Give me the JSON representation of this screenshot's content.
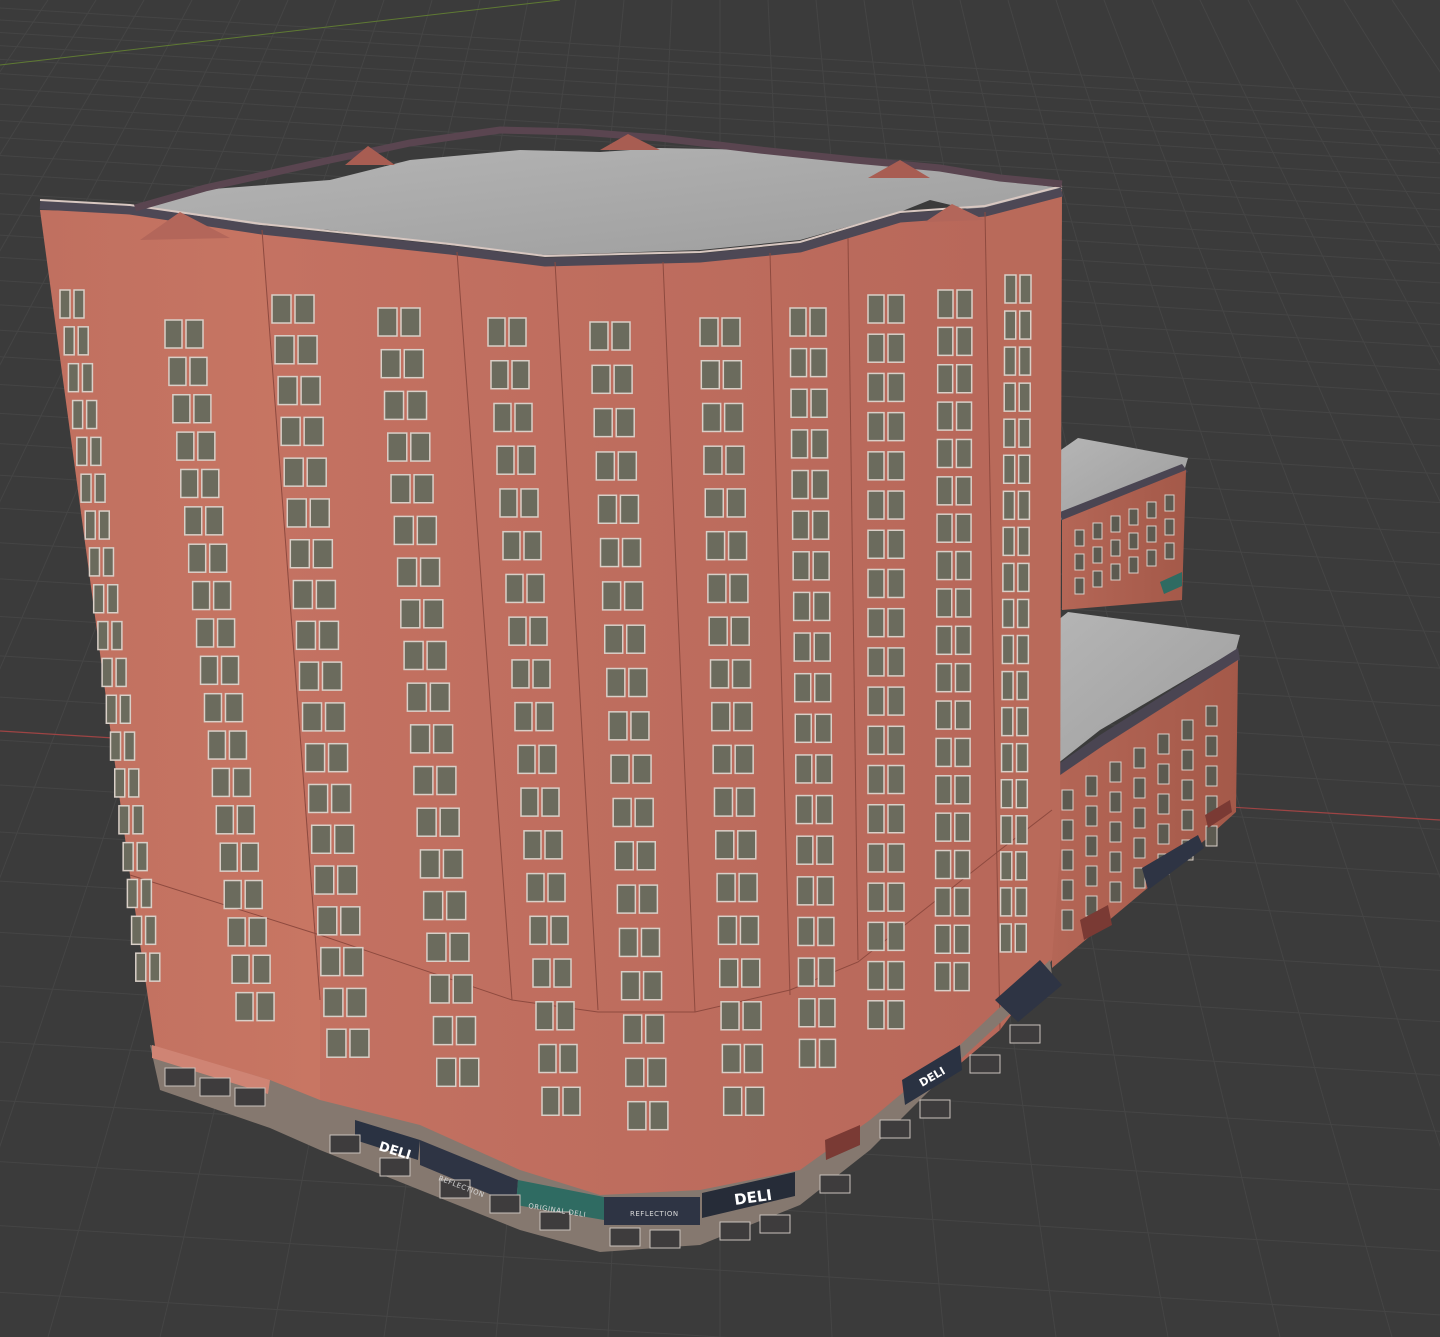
{
  "viewport": {
    "background_color": "#3b3b3b",
    "grid_color": "#454545",
    "x_axis_color": "#b04848",
    "y_axis_color": "#6f8a3a"
  },
  "model": {
    "brick_color": "#c4715f",
    "brick_dark": "#a95a4b",
    "roof_color": "#a3a3a3",
    "cornice_color": "#4d4855",
    "window_color": "#6b6b5d",
    "awning_dark": "#2e3444",
    "awning_green": "#2f6b62"
  },
  "storefront_signs": {
    "deli_left": "DELI",
    "deli_right": "DELI",
    "deli_corner": "DELI",
    "awning_left": "REFLECTION",
    "awning_center": "REFLECTION",
    "awning_green": "ORIGINAL DELI"
  }
}
